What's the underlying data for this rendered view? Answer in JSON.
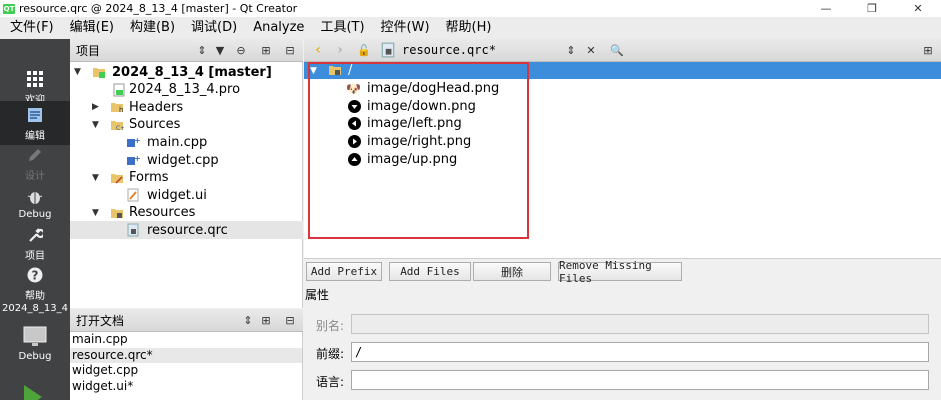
{
  "window": {
    "title": "resource.qrc @ 2024_8_13_4 [master] - Qt Creator",
    "logo_text": "QT"
  },
  "menu": [
    "文件(F)",
    "编辑(E)",
    "构建(B)",
    "调试(D)",
    "Analyze",
    "工具(T)",
    "控件(W)",
    "帮助(H)"
  ],
  "modes": {
    "welcome": "欢迎",
    "edit": "编辑",
    "design": "设计",
    "debug": "Debug",
    "projects": "项目",
    "help": "帮助",
    "project_name": "2024_8_13_4",
    "kit_label": "Debug"
  },
  "project_panel": {
    "title": "项目",
    "tree": {
      "root": "2024_8_13_4 [master]",
      "pro_file": "2024_8_13_4.pro",
      "headers": "Headers",
      "sources": "Sources",
      "main_cpp": "main.cpp",
      "widget_cpp": "widget.cpp",
      "forms": "Forms",
      "widget_ui": "widget.ui",
      "resources": "Resources",
      "resource_qrc": "resource.qrc"
    }
  },
  "open_docs": {
    "title": "打开文档",
    "items": [
      "main.cpp",
      "resource.qrc*",
      "widget.cpp",
      "widget.ui*"
    ]
  },
  "editor": {
    "file_combo": "resource.qrc*",
    "prefix": "/",
    "files": [
      "image/dogHead.png",
      "image/down.png",
      "image/left.png",
      "image/right.png",
      "image/up.png"
    ],
    "buttons": {
      "add_prefix": "Add Prefix",
      "add_files": "Add Files",
      "remove": "删除",
      "remove_missing": "Remove Missing Files"
    },
    "properties": {
      "title": "属性",
      "alias_label": "别名:",
      "alias_value": "",
      "prefix_label": "前缀:",
      "prefix_value": "/",
      "lang_label": "语言:",
      "lang_value": ""
    }
  },
  "colors": {
    "modebar": "#404244",
    "selection": "#3c8ddc",
    "highlight_box": "#d9353d"
  }
}
